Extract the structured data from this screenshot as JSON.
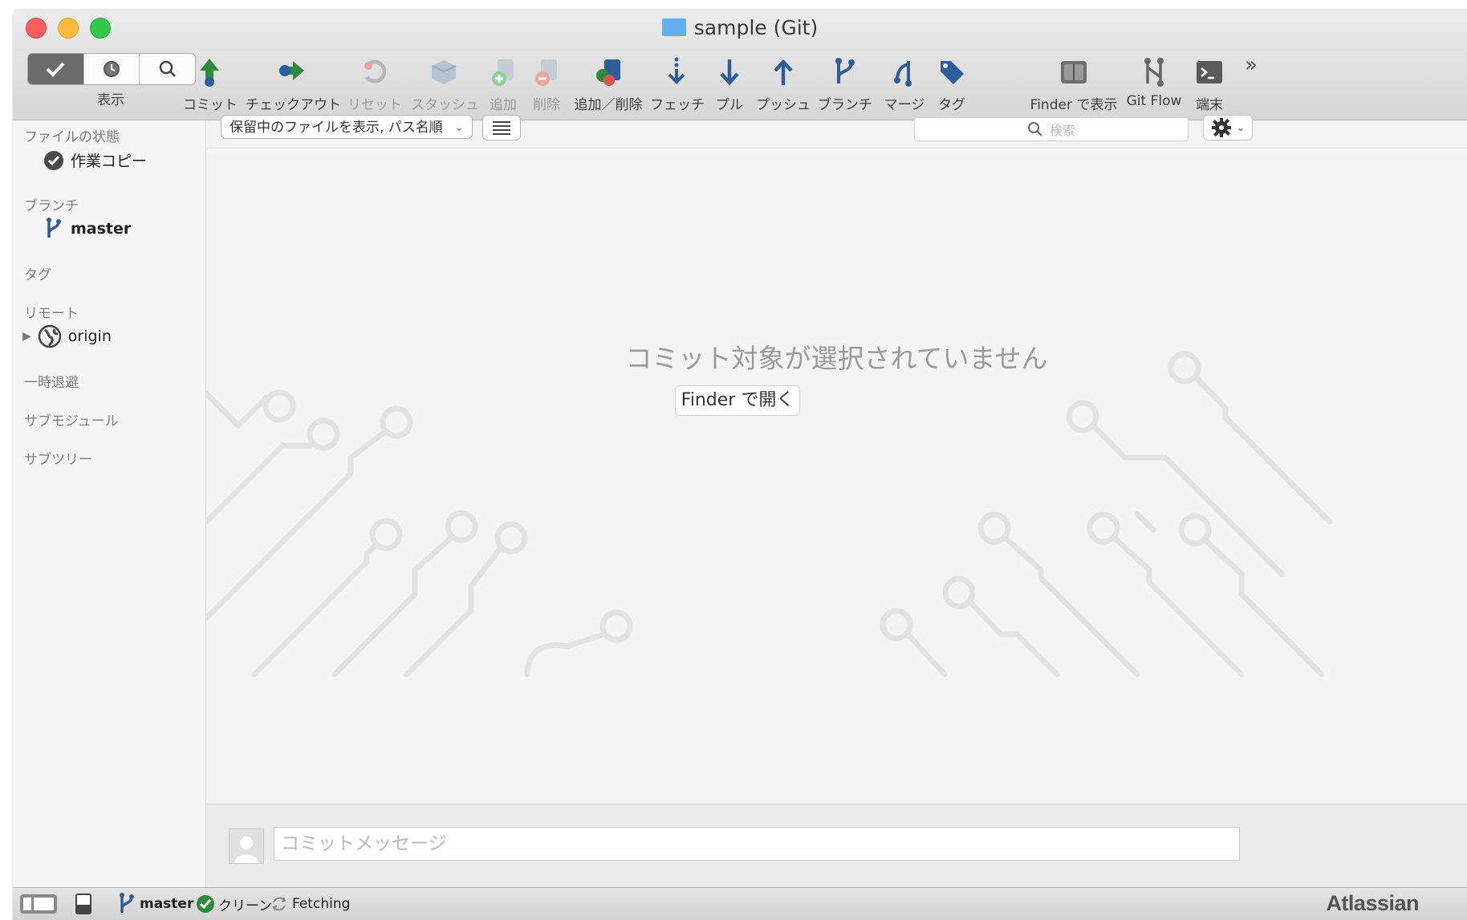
{
  "window": {
    "title": "sample (Git)"
  },
  "toolbar": {
    "view_label": "表示",
    "buttons": [
      {
        "label": "コミット",
        "icon": "commit-icon"
      },
      {
        "label": "チェックアウト",
        "icon": "checkout-icon"
      },
      {
        "label": "リセット",
        "icon": "reset-icon"
      },
      {
        "label": "スタッシュ",
        "icon": "stash-icon"
      },
      {
        "label": "追加",
        "icon": "add-icon"
      },
      {
        "label": "削除",
        "icon": "remove-icon"
      },
      {
        "label": "追加／削除",
        "icon": "add-remove-icon"
      },
      {
        "label": "フェッチ",
        "icon": "fetch-icon"
      },
      {
        "label": "プル",
        "icon": "pull-icon"
      },
      {
        "label": "プッシュ",
        "icon": "push-icon"
      },
      {
        "label": "ブランチ",
        "icon": "branch-icon"
      },
      {
        "label": "マージ",
        "icon": "merge-icon"
      },
      {
        "label": "タグ",
        "icon": "tag-icon"
      },
      {
        "label": "Finder で表示",
        "icon": "finder-icon"
      },
      {
        "label": "Git Flow",
        "icon": "git-flow-icon"
      },
      {
        "label": "端末",
        "icon": "terminal-icon"
      }
    ],
    "overflow": "»"
  },
  "sidebar": {
    "file_status": {
      "header": "ファイルの状態",
      "item": "作業コピー"
    },
    "branches": {
      "header": "ブランチ",
      "item": "master"
    },
    "tags": {
      "header": "タグ"
    },
    "remotes": {
      "header": "リモート",
      "item": "origin"
    },
    "stashes": {
      "header": "一時退避"
    },
    "submodules": {
      "header": "サブモジュール"
    },
    "subtrees": {
      "header": "サブツリー"
    }
  },
  "filter": {
    "selected": "保留中のファイルを表示, パス名順",
    "search_placeholder": "検索"
  },
  "main": {
    "empty_message": "コミット対象が選択されていません",
    "open_finder_label": "Finder で開く",
    "commit_placeholder": "コミットメッセージ"
  },
  "status": {
    "branch": "master",
    "clean": "クリーン",
    "activity": "Fetching",
    "brand": "Atlassian"
  },
  "colors": {
    "accent_green": "#2e8b3c",
    "accent_blue": "#2f5d9a",
    "remove_red": "#d9534f",
    "window_bg": "#f3f3f3"
  }
}
